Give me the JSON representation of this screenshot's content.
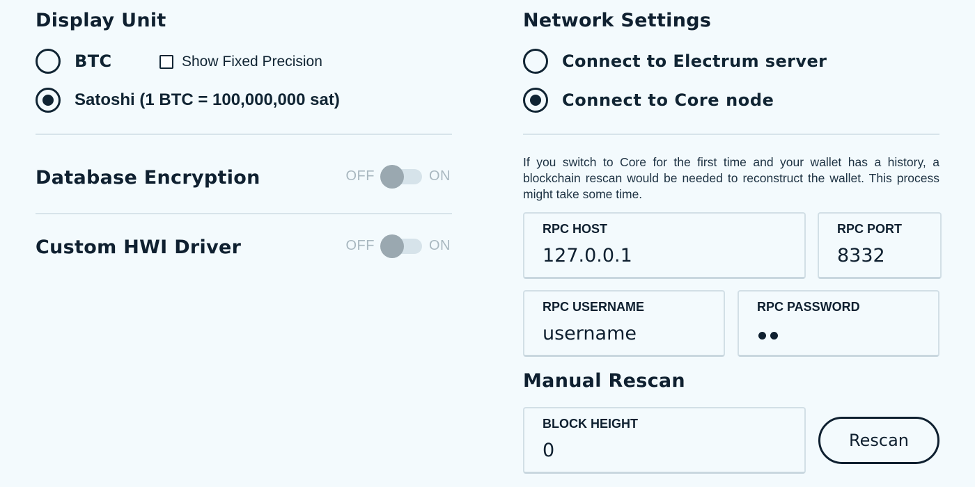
{
  "display_unit": {
    "heading": "Display Unit",
    "btc_label": "BTC",
    "show_fixed_precision_label": "Show Fixed Precision",
    "satoshi_label": "Satoshi (1 BTC = 100,000,000 sat)",
    "selected": "satoshi",
    "show_fixed_precision_checked": false
  },
  "database_encryption": {
    "heading": "Database Encryption",
    "off_label": "OFF",
    "on_label": "ON",
    "enabled": false
  },
  "custom_hwi_driver": {
    "heading": "Custom HWI Driver",
    "off_label": "OFF",
    "on_label": "ON",
    "enabled": false
  },
  "network_settings": {
    "heading": "Network Settings",
    "electrum_label": "Connect to Electrum server",
    "core_label": "Connect to Core node",
    "selected": "core",
    "info_text": "If you switch to Core for the first time and your wallet has a history, a blockchain rescan would be needed to reconstruct the wallet. This process might take some time."
  },
  "rpc": {
    "host_label": "RPC HOST",
    "host_value": "127.0.0.1",
    "port_label": "RPC PORT",
    "port_value": "8332",
    "username_label": "RPC USERNAME",
    "username_value": "username",
    "password_label": "RPC PASSWORD",
    "password_length": 2
  },
  "manual_rescan": {
    "heading": "Manual Rescan",
    "block_height_label": "BLOCK HEIGHT",
    "block_height_value": "0",
    "rescan_button_label": "Rescan"
  },
  "colors": {
    "background": "#f3fafd",
    "text": "#0f2030",
    "divider": "#d7e4ea",
    "toggle_knob": "#9aa8b0",
    "toggle_track": "#d6e3ea"
  }
}
